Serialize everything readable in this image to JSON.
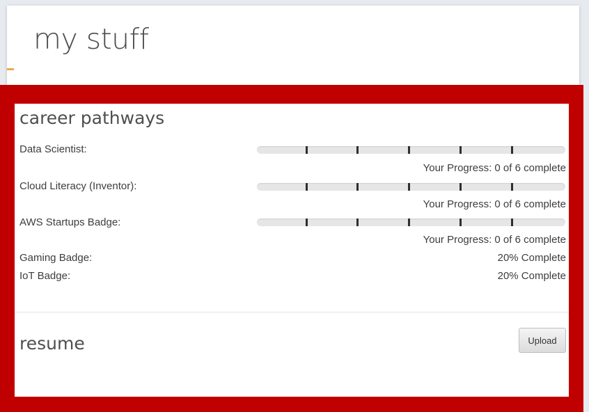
{
  "page": {
    "title": "my stuff"
  },
  "colors": {
    "highlight_frame": "#c00000",
    "progress_track": "#e6e6e6",
    "progress_tick": "#2e2e2e",
    "card_background": "#ffffff"
  },
  "career_pathways": {
    "title": "career pathways",
    "items": [
      {
        "label": "Data Scientist:",
        "progress_text": "Your Progress: 0 of 6 complete",
        "completed": 0,
        "total": 6
      },
      {
        "label": "Cloud Literacy (Inventor):",
        "progress_text": "Your Progress: 0 of 6 complete",
        "completed": 0,
        "total": 6
      },
      {
        "label": "AWS Startups Badge:",
        "progress_text": "Your Progress: 0 of 6 complete",
        "completed": 0,
        "total": 6
      },
      {
        "label": "Gaming Badge:",
        "progress_text": "20% Complete"
      },
      {
        "label": "IoT Badge:",
        "progress_text": "20% Complete"
      }
    ]
  },
  "resume": {
    "title": "resume",
    "upload_label": "Upload"
  }
}
